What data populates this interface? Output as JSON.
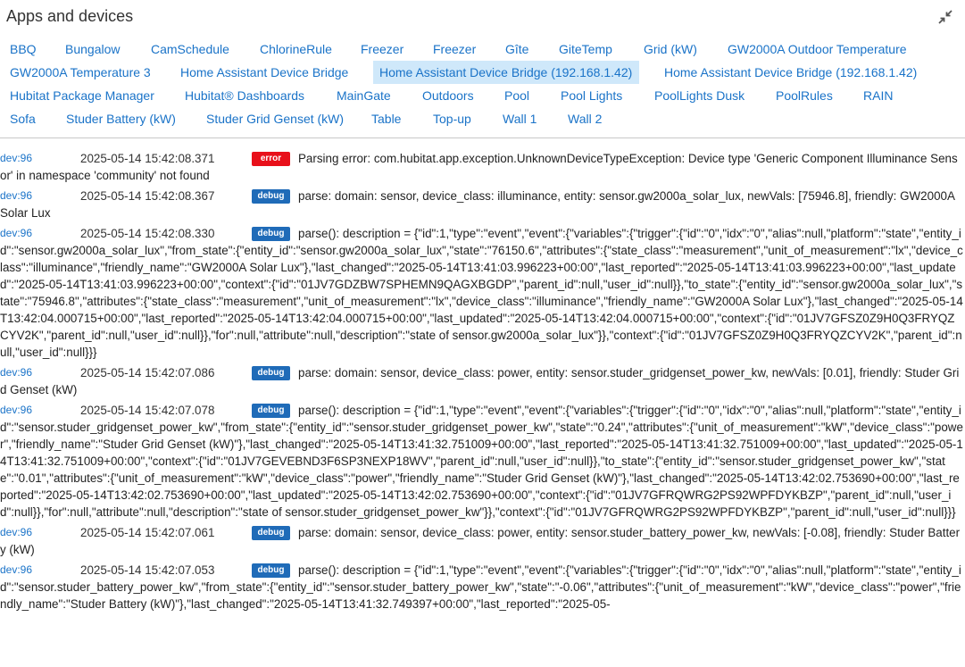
{
  "header": {
    "title": "Apps and devices"
  },
  "tabs": [
    [
      "BBQ",
      "Bungalow",
      "CamSchedule",
      "ChlorineRule",
      "Freezer",
      "Freezer",
      "Gîte",
      "GiteTemp",
      "Grid (kW)",
      "GW2000A Outdoor Temperature"
    ],
    [
      "GW2000A Temperature 3",
      "Home Assistant Device Bridge",
      "Home Assistant Device Bridge (192.168.1.42)",
      "Home Assistant Device Bridge (192.168.1.42)"
    ],
    [
      "Hubitat Package Manager",
      "Hubitat® Dashboards",
      "MainGate",
      "Outdoors",
      "Pool",
      "Pool Lights",
      "PoolLights Dusk",
      "PoolRules",
      "RAIN"
    ],
    [
      "Sofa",
      "Studer Battery (kW)",
      "Studer Grid Genset (kW)",
      "Table",
      "Top-up",
      "Wall 1",
      "Wall 2"
    ]
  ],
  "selected_tab": "Home Assistant Device Bridge (192.168.1.42)",
  "log": [
    {
      "dev": "dev:96",
      "time": "2025-05-14 15:42:08.371",
      "level": "error",
      "msg": "Parsing error: com.hubitat.app.exception.UnknownDeviceTypeException: Device type 'Generic Component Illuminance Sensor' in namespace 'community' not found"
    },
    {
      "dev": "dev:96",
      "time": "2025-05-14 15:42:08.367",
      "level": "debug",
      "msg": "parse: domain: sensor, device_class: illuminance, entity: sensor.gw2000a_solar_lux, newVals: [75946.8], friendly: GW2000A Solar Lux"
    },
    {
      "dev": "dev:96",
      "time": "2025-05-14 15:42:08.330",
      "level": "debug",
      "msg": "parse(): description = {\"id\":1,\"type\":\"event\",\"event\":{\"variables\":{\"trigger\":{\"id\":\"0\",\"idx\":\"0\",\"alias\":null,\"platform\":\"state\",\"entity_id\":\"sensor.gw2000a_solar_lux\",\"from_state\":{\"entity_id\":\"sensor.gw2000a_solar_lux\",\"state\":\"76150.6\",\"attributes\":{\"state_class\":\"measurement\",\"unit_of_measurement\":\"lx\",\"device_class\":\"illuminance\",\"friendly_name\":\"GW2000A Solar Lux\"},\"last_changed\":\"2025-05-14T13:41:03.996223+00:00\",\"last_reported\":\"2025-05-14T13:41:03.996223+00:00\",\"last_updated\":\"2025-05-14T13:41:03.996223+00:00\",\"context\":{\"id\":\"01JV7GDZBW7SPHEMN9QAGXBGDP\",\"parent_id\":null,\"user_id\":null}},\"to_state\":{\"entity_id\":\"sensor.gw2000a_solar_lux\",\"state\":\"75946.8\",\"attributes\":{\"state_class\":\"measurement\",\"unit_of_measurement\":\"lx\",\"device_class\":\"illuminance\",\"friendly_name\":\"GW2000A Solar Lux\"},\"last_changed\":\"2025-05-14T13:42:04.000715+00:00\",\"last_reported\":\"2025-05-14T13:42:04.000715+00:00\",\"last_updated\":\"2025-05-14T13:42:04.000715+00:00\",\"context\":{\"id\":\"01JV7GFSZ0Z9H0Q3FRYQZCYV2K\",\"parent_id\":null,\"user_id\":null}},\"for\":null,\"attribute\":null,\"description\":\"state of sensor.gw2000a_solar_lux\"}},\"context\":{\"id\":\"01JV7GFSZ0Z9H0Q3FRYQZCYV2K\",\"parent_id\":null,\"user_id\":null}}}"
    },
    {
      "dev": "dev:96",
      "time": "2025-05-14 15:42:07.086",
      "level": "debug",
      "msg": "parse: domain: sensor, device_class: power, entity: sensor.studer_gridgenset_power_kw, newVals: [0.01], friendly: Studer Grid Genset (kW)"
    },
    {
      "dev": "dev:96",
      "time": "2025-05-14 15:42:07.078",
      "level": "debug",
      "msg": "parse(): description = {\"id\":1,\"type\":\"event\",\"event\":{\"variables\":{\"trigger\":{\"id\":\"0\",\"idx\":\"0\",\"alias\":null,\"platform\":\"state\",\"entity_id\":\"sensor.studer_gridgenset_power_kw\",\"from_state\":{\"entity_id\":\"sensor.studer_gridgenset_power_kw\",\"state\":\"0.24\",\"attributes\":{\"unit_of_measurement\":\"kW\",\"device_class\":\"power\",\"friendly_name\":\"Studer Grid Genset (kW)\"},\"last_changed\":\"2025-05-14T13:41:32.751009+00:00\",\"last_reported\":\"2025-05-14T13:41:32.751009+00:00\",\"last_updated\":\"2025-05-14T13:41:32.751009+00:00\",\"context\":{\"id\":\"01JV7GEVEBND3F6SP3NEXP18WV\",\"parent_id\":null,\"user_id\":null}},\"to_state\":{\"entity_id\":\"sensor.studer_gridgenset_power_kw\",\"state\":\"0.01\",\"attributes\":{\"unit_of_measurement\":\"kW\",\"device_class\":\"power\",\"friendly_name\":\"Studer Grid Genset (kW)\"},\"last_changed\":\"2025-05-14T13:42:02.753690+00:00\",\"last_reported\":\"2025-05-14T13:42:02.753690+00:00\",\"last_updated\":\"2025-05-14T13:42:02.753690+00:00\",\"context\":{\"id\":\"01JV7GFRQWRG2PS92WPFDYKBZP\",\"parent_id\":null,\"user_id\":null}},\"for\":null,\"attribute\":null,\"description\":\"state of sensor.studer_gridgenset_power_kw\"}},\"context\":{\"id\":\"01JV7GFRQWRG2PS92WPFDYKBZP\",\"parent_id\":null,\"user_id\":null}}}"
    },
    {
      "dev": "dev:96",
      "time": "2025-05-14 15:42:07.061",
      "level": "debug",
      "msg": "parse: domain: sensor, device_class: power, entity: sensor.studer_battery_power_kw, newVals: [-0.08], friendly: Studer Battery (kW)"
    },
    {
      "dev": "dev:96",
      "time": "2025-05-14 15:42:07.053",
      "level": "debug",
      "msg": "parse(): description = {\"id\":1,\"type\":\"event\",\"event\":{\"variables\":{\"trigger\":{\"id\":\"0\",\"idx\":\"0\",\"alias\":null,\"platform\":\"state\",\"entity_id\":\"sensor.studer_battery_power_kw\",\"from_state\":{\"entity_id\":\"sensor.studer_battery_power_kw\",\"state\":\"-0.06\",\"attributes\":{\"unit_of_measurement\":\"kW\",\"device_class\":\"power\",\"friendly_name\":\"Studer Battery (kW)\"},\"last_changed\":\"2025-05-14T13:41:32.749397+00:00\",\"last_reported\":\"2025-05-"
    }
  ]
}
